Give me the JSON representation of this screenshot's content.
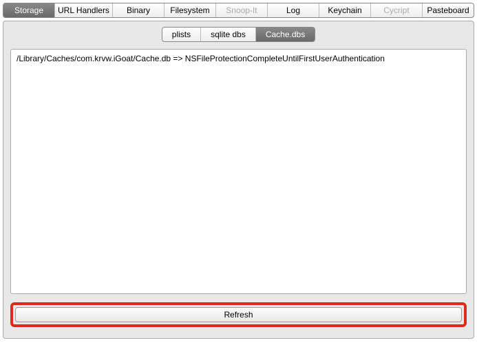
{
  "topTabs": [
    {
      "label": "Storage",
      "active": true,
      "disabled": false
    },
    {
      "label": "URL Handlers",
      "active": false,
      "disabled": false
    },
    {
      "label": "Binary",
      "active": false,
      "disabled": false
    },
    {
      "label": "Filesystem",
      "active": false,
      "disabled": false
    },
    {
      "label": "Snoop-It",
      "active": false,
      "disabled": true
    },
    {
      "label": "Log",
      "active": false,
      "disabled": false
    },
    {
      "label": "Keychain",
      "active": false,
      "disabled": false
    },
    {
      "label": "Cycript",
      "active": false,
      "disabled": true
    },
    {
      "label": "Pasteboard",
      "active": false,
      "disabled": false
    }
  ],
  "subTabs": [
    {
      "label": "plists",
      "active": false
    },
    {
      "label": "sqlite dbs",
      "active": false
    },
    {
      "label": "Cache.dbs",
      "active": true
    }
  ],
  "content": {
    "line": "/Library/Caches/com.krvw.iGoat/Cache.db => NSFileProtectionCompleteUntilFirstUserAuthentication"
  },
  "buttons": {
    "refresh": "Refresh"
  }
}
